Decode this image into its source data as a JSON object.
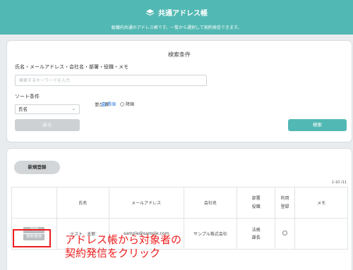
{
  "header": {
    "title": "共通アドレス帳",
    "subtitle": "組織内共通のアドレス帳です。一覧から選択して契約発信できます。"
  },
  "search": {
    "title": "検索条件",
    "keyword_label": "氏名・メールアドレス・会社名・部署・役職・メモ",
    "keyword_placeholder": "検索するキーワードを入力",
    "sort_label": "ソート条件",
    "sort_value": "氏名",
    "order_label": "並び順：",
    "order_options": [
      "昇順",
      "降順"
    ],
    "back_label": "戻る",
    "search_label": "検索"
  },
  "list": {
    "new_label": "新規登録",
    "count": "1-10 /11",
    "columns": [
      "",
      "氏名",
      "メールアドレス",
      "会社名",
      "部署",
      "役職",
      "利用",
      "登録",
      "メモ"
    ],
    "rows": [
      {
        "detail_label": "詳細",
        "send_label": "契約発信",
        "name": "テスト　太郎",
        "email": "sample@sample.com",
        "company": "サンプル株式会社",
        "dept": "法務",
        "position": "課長"
      }
    ]
  },
  "annotation": {
    "line1": "アドレス帳から対象者の",
    "line2": "契約発信をクリック"
  },
  "colors": {
    "header": "#52b8b3",
    "accent_radio": "#2a7de1",
    "annotation": "#ee1c1c"
  }
}
